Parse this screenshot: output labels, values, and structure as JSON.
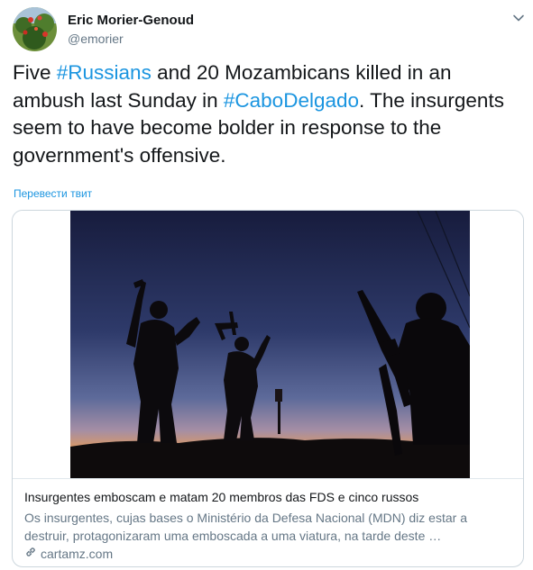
{
  "author": {
    "name": "Eric Morier-Genoud",
    "handle": "@emorier"
  },
  "tweet": {
    "t1": "Five ",
    "tag1": "#Russians",
    "t2": " and 20 Mozambicans killed in an ambush last Sunday in ",
    "tag2": "#CaboDelgado",
    "t3": ". The insurgents seem to have become bolder in response to the government's offensive."
  },
  "translate_link": "Перевести твит",
  "card": {
    "title": "Insurgentes emboscam e matam 20 membros das FDS e cinco russos",
    "description": "Os insurgentes, cujas bases o Ministério da Defesa Nacional (MDN) diz estar a destruir, protagonizaram uma emboscada a uma viatura, na tarde deste …",
    "domain": "cartamz.com"
  },
  "icons": {
    "menu": "chevron-down-icon",
    "link": "link-icon"
  },
  "colors": {
    "link_blue": "#1b95e0",
    "muted": "#657786",
    "text": "#14171a"
  }
}
